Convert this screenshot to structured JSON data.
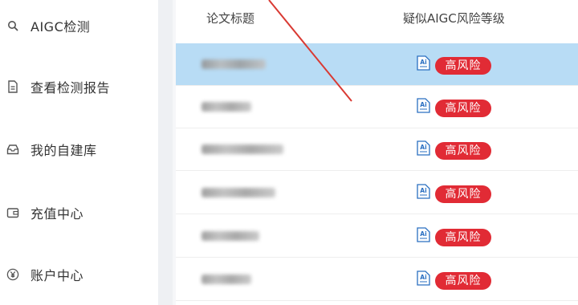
{
  "sidebar": {
    "items": [
      {
        "icon": "search-icon",
        "label": "AIGC检测"
      },
      {
        "icon": "document-icon",
        "label": "查看检测报告"
      },
      {
        "icon": "inbox-icon",
        "label": "我的自建库"
      },
      {
        "icon": "wallet-icon",
        "label": "充值中心"
      },
      {
        "icon": "yen-icon",
        "label": "账户中心"
      }
    ]
  },
  "table": {
    "headers": {
      "title": "论文标题",
      "risk": "疑似AIGC风险等级"
    },
    "rows": [
      {
        "title": "",
        "risk": "高风险",
        "selected": true
      },
      {
        "title": "",
        "risk": "高风险",
        "selected": false
      },
      {
        "title": "",
        "risk": "高风险",
        "selected": false
      },
      {
        "title": "",
        "risk": "高风险",
        "selected": false
      },
      {
        "title": "",
        "risk": "高风险",
        "selected": false
      },
      {
        "title": "",
        "risk": "高风险",
        "selected": false
      }
    ]
  },
  "colors": {
    "badge_bg": "#e12b35",
    "selected_row": "#b8dcf5",
    "arrow": "#d93a33"
  }
}
